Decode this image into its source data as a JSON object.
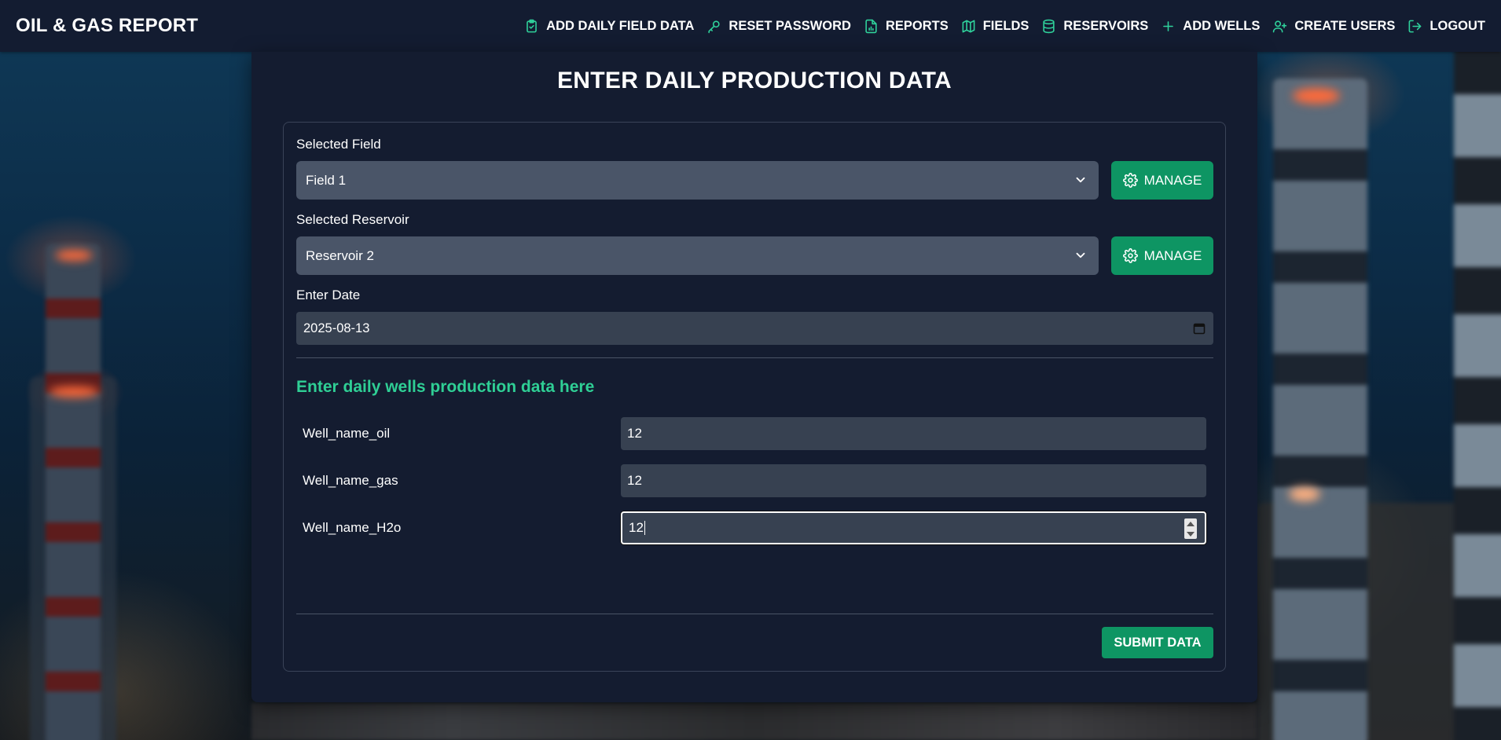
{
  "app": {
    "brand": "OIL & GAS REPORT"
  },
  "nav": {
    "items": [
      {
        "label": "ADD DAILY FIELD DATA",
        "icon": "clipboard-check-icon"
      },
      {
        "label": "RESET PASSWORD",
        "icon": "key-icon"
      },
      {
        "label": "REPORTS",
        "icon": "file-chart-icon"
      },
      {
        "label": "FIELDS",
        "icon": "map-icon"
      },
      {
        "label": "RESERVOIRS",
        "icon": "database-icon"
      },
      {
        "label": "ADD WELLS",
        "icon": "plus-icon"
      },
      {
        "label": "CREATE USERS",
        "icon": "user-plus-icon"
      },
      {
        "label": "LOGOUT",
        "icon": "logout-icon"
      }
    ],
    "icon_color": "#2fd19b"
  },
  "page": {
    "title": "ENTER DAILY PRODUCTION DATA"
  },
  "form": {
    "field": {
      "label": "Selected Field",
      "value": "Field 1",
      "manage_label": "MANAGE"
    },
    "reservoir": {
      "label": "Selected Reservoir",
      "value": "Reservoir 2",
      "manage_label": "MANAGE"
    },
    "date": {
      "label": "Enter Date",
      "value": "2025-08-13"
    },
    "wells_heading": "Enter daily wells production data here",
    "wells": [
      {
        "name": "Well_name_oil",
        "value": "12"
      },
      {
        "name": "Well_name_gas",
        "value": "12"
      },
      {
        "name": "Well_name_H2o",
        "value": "12"
      }
    ],
    "submit_label": "SUBMIT DATA"
  },
  "colors": {
    "accent": "#0e9563",
    "heading_green": "#2fcf95",
    "panel": "#141c30",
    "navbar": "#131c31",
    "select_bg": "#4a5568",
    "input_bg": "#374151"
  }
}
